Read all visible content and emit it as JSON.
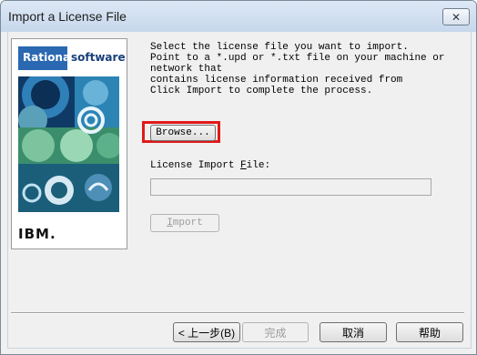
{
  "window": {
    "title": "Import a License File",
    "close_glyph": "✕"
  },
  "sidebar": {
    "logo_rational": "Rational.",
    "logo_software": "software",
    "ibm": "IBM."
  },
  "instructions": [
    "Select the license file you want to import.",
    "Point to a *.upd or *.txt file on your machine or",
    "network that",
    "contains license information received from",
    "Click Import to complete the process."
  ],
  "browse_button": {
    "label": "Browse..."
  },
  "license_field": {
    "label_prefix": "License Import ",
    "label_accel": "F",
    "label_suffix": "ile:",
    "value": ""
  },
  "import_button": {
    "accel": "I",
    "rest": "mport"
  },
  "footer": {
    "back": "< 上一步(B)",
    "finish": "完成",
    "cancel": "取消",
    "help": "帮助"
  },
  "colors": {
    "highlight": "#e01a1a",
    "rational_blue": "#2a68b1"
  }
}
